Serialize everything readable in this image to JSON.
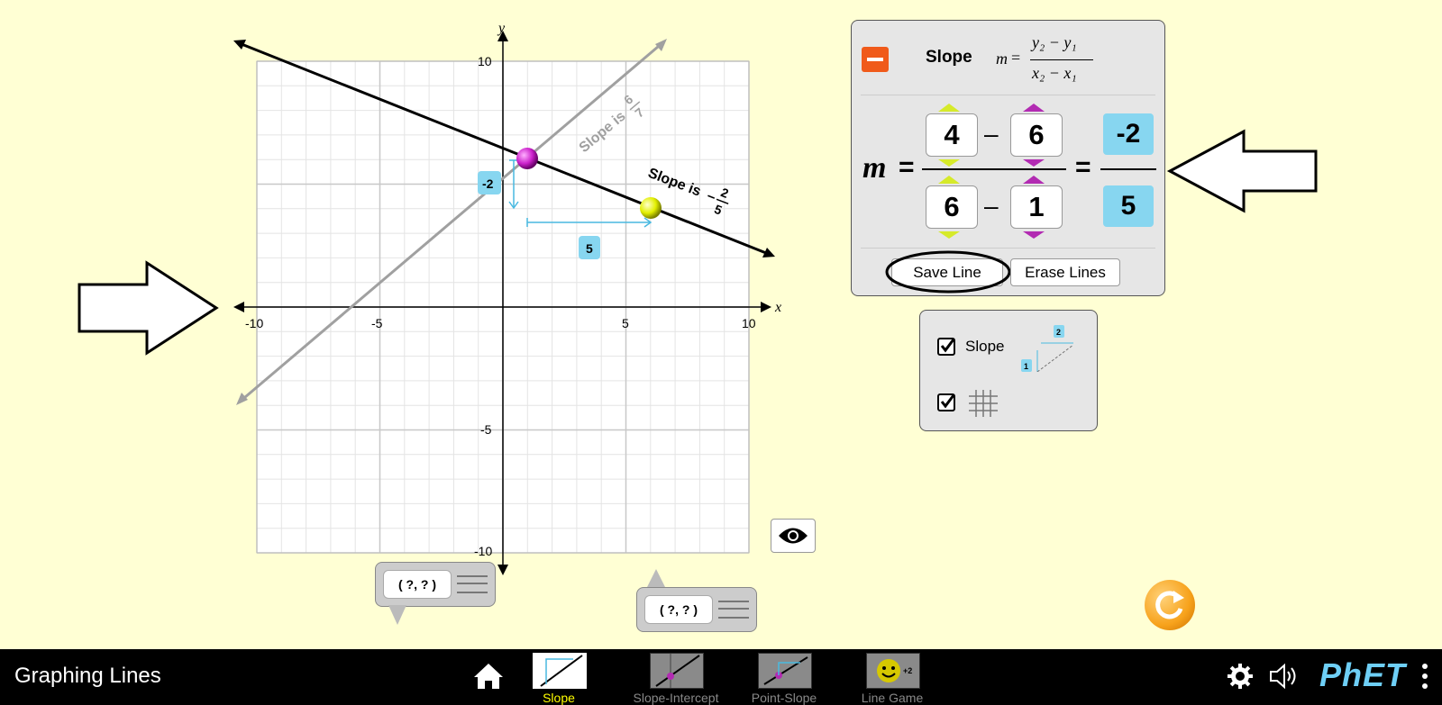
{
  "app": {
    "title": "Graphing Lines"
  },
  "graph": {
    "x_axis_label": "x",
    "y_axis_label": "y",
    "x_ticks": [
      "-10",
      "-5",
      "5",
      "10"
    ],
    "y_ticks": [
      "10",
      "-5",
      "-10"
    ],
    "x_range": [
      -10,
      10
    ],
    "y_range": [
      -10,
      10
    ],
    "saved_line_slope_text": "Slope is",
    "saved_line_slope_num": "6",
    "saved_line_slope_den": "7",
    "current_line_slope_text": "Slope is",
    "current_line_slope_sign": "–",
    "current_line_slope_num": "2",
    "current_line_slope_den": "5",
    "rise_label": "-2",
    "run_label": "5",
    "point1": {
      "x": 1,
      "y": 6
    },
    "point2": {
      "x": 6,
      "y": 4
    },
    "saved_line": {
      "slope": "6/7",
      "points": [
        [
          -10,
          -4
        ],
        [
          6,
          10
        ]
      ]
    },
    "current_line": {
      "slope": "-2/5"
    }
  },
  "equation_panel": {
    "title": "Slope",
    "formula_m": "m",
    "formula_eq": "=",
    "formula_num": "y₂ − y₁",
    "formula_den": "x₂ − x₁",
    "m_label": "m",
    "eq1": "=",
    "eq2": "=",
    "y2": "4",
    "y1": "6",
    "x2": "6",
    "x1": "1",
    "minus": "–",
    "result_num": "-2",
    "result_den": "5",
    "save_label": "Save Line",
    "erase_label": "Erase Lines"
  },
  "options_panel": {
    "slope_label": "Slope",
    "slope_checked": true,
    "grid_checked": true,
    "icon_rise": "1",
    "icon_run": "2"
  },
  "coord_tools": [
    {
      "label": "( ?, ? )"
    },
    {
      "label": "( ?, ? )"
    }
  ],
  "nav": {
    "tabs": [
      {
        "label": "Slope",
        "active": true
      },
      {
        "label": "Slope-Intercept",
        "active": false
      },
      {
        "label": "Point-Slope",
        "active": false
      },
      {
        "label": "Line Game",
        "active": false
      }
    ],
    "brand": "PhET",
    "line_game_badge": "+2"
  },
  "colors": {
    "background": "#ffffd4",
    "accent_blue": "#87d6f0",
    "tab_active": "#ffff00",
    "minus_button": "#f05a1a",
    "reset_orange": "#f7a21b",
    "point1": "#cc22cc",
    "point2": "#e2ef00"
  }
}
